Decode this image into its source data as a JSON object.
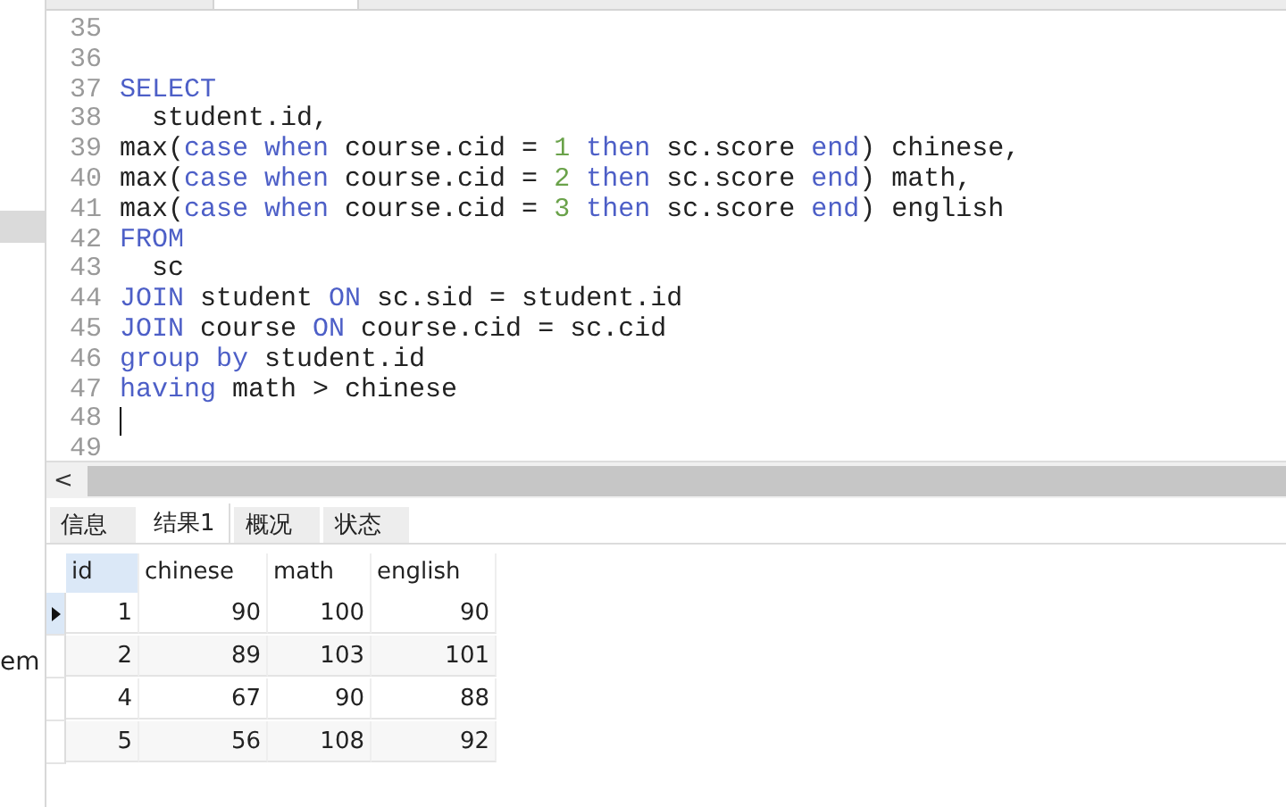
{
  "sidebar": {
    "items": [
      {
        "selected": true
      },
      {
        "label": "em",
        "selected": false
      }
    ]
  },
  "editor": {
    "lines": [
      {
        "number": "35",
        "cursor": false
      },
      {
        "number": "36",
        "cursor": false
      },
      {
        "number": "37",
        "cursor": false,
        "tokens": [
          {
            "kind": "keyword",
            "text": "SELECT"
          }
        ]
      },
      {
        "number": "38",
        "cursor": false,
        "tokens": [
          {
            "kind": "plain",
            "text": "  student.id,"
          }
        ]
      },
      {
        "number": "39",
        "cursor": false,
        "tokens": [
          {
            "kind": "plain",
            "text": "max("
          },
          {
            "kind": "keyword",
            "text": "case when"
          },
          {
            "kind": "plain",
            "text": " course.cid = "
          },
          {
            "kind": "number",
            "text": "1"
          },
          {
            "kind": "keyword",
            "text": " then"
          },
          {
            "kind": "plain",
            "text": " sc.score "
          },
          {
            "kind": "keyword",
            "text": "end"
          },
          {
            "kind": "plain",
            "text": ") chinese,"
          }
        ]
      },
      {
        "number": "40",
        "cursor": false,
        "tokens": [
          {
            "kind": "plain",
            "text": "max("
          },
          {
            "kind": "keyword",
            "text": "case when"
          },
          {
            "kind": "plain",
            "text": " course.cid = "
          },
          {
            "kind": "number",
            "text": "2"
          },
          {
            "kind": "keyword",
            "text": " then"
          },
          {
            "kind": "plain",
            "text": " sc.score "
          },
          {
            "kind": "keyword",
            "text": "end"
          },
          {
            "kind": "plain",
            "text": ") math,"
          }
        ]
      },
      {
        "number": "41",
        "cursor": false,
        "tokens": [
          {
            "kind": "plain",
            "text": "max("
          },
          {
            "kind": "keyword",
            "text": "case when"
          },
          {
            "kind": "plain",
            "text": " course.cid = "
          },
          {
            "kind": "number",
            "text": "3"
          },
          {
            "kind": "keyword",
            "text": " then"
          },
          {
            "kind": "plain",
            "text": " sc.score "
          },
          {
            "kind": "keyword",
            "text": "end"
          },
          {
            "kind": "plain",
            "text": ") english"
          }
        ]
      },
      {
        "number": "42",
        "cursor": false,
        "tokens": [
          {
            "kind": "keyword",
            "text": "FROM"
          }
        ]
      },
      {
        "number": "43",
        "cursor": false,
        "tokens": [
          {
            "kind": "plain",
            "text": "  sc"
          }
        ]
      },
      {
        "number": "44",
        "cursor": false,
        "tokens": [
          {
            "kind": "keyword",
            "text": "JOIN"
          },
          {
            "kind": "plain",
            "text": " student "
          },
          {
            "kind": "keyword",
            "text": "ON"
          },
          {
            "kind": "plain",
            "text": " sc.sid = student.id"
          }
        ]
      },
      {
        "number": "45",
        "cursor": false,
        "tokens": [
          {
            "kind": "keyword",
            "text": "JOIN"
          },
          {
            "kind": "plain",
            "text": " course "
          },
          {
            "kind": "keyword",
            "text": "ON"
          },
          {
            "kind": "plain",
            "text": " course.cid = sc.cid"
          }
        ]
      },
      {
        "number": "46",
        "cursor": false,
        "tokens": [
          {
            "kind": "keyword",
            "text": "group by"
          },
          {
            "kind": "plain",
            "text": " student.id"
          }
        ]
      },
      {
        "number": "47",
        "cursor": false,
        "tokens": [
          {
            "kind": "keyword",
            "text": "having"
          },
          {
            "kind": "plain",
            "text": " math > chinese"
          }
        ]
      },
      {
        "number": "48",
        "cursor": true
      },
      {
        "number": "49",
        "cursor": false
      }
    ]
  },
  "scrollbar": {
    "left_arrow": "<"
  },
  "result_tabs": [
    {
      "label": "信息",
      "selected": false
    },
    {
      "label": "结果1",
      "selected": true
    },
    {
      "label": "概况",
      "selected": false
    },
    {
      "label": "状态",
      "selected": false
    }
  ],
  "table": {
    "columns": [
      {
        "label": "id",
        "selected": true
      },
      {
        "label": "chinese",
        "selected": false
      },
      {
        "label": "math",
        "selected": false
      },
      {
        "label": "english",
        "selected": false
      }
    ],
    "rows": [
      {
        "current": true,
        "cells": [
          "1",
          "90",
          "100",
          "90"
        ]
      },
      {
        "current": false,
        "cells": [
          "2",
          "89",
          "103",
          "101"
        ]
      },
      {
        "current": false,
        "cells": [
          "4",
          "67",
          "90",
          "88"
        ]
      },
      {
        "current": false,
        "cells": [
          "5",
          "56",
          "108",
          "92"
        ]
      }
    ]
  }
}
